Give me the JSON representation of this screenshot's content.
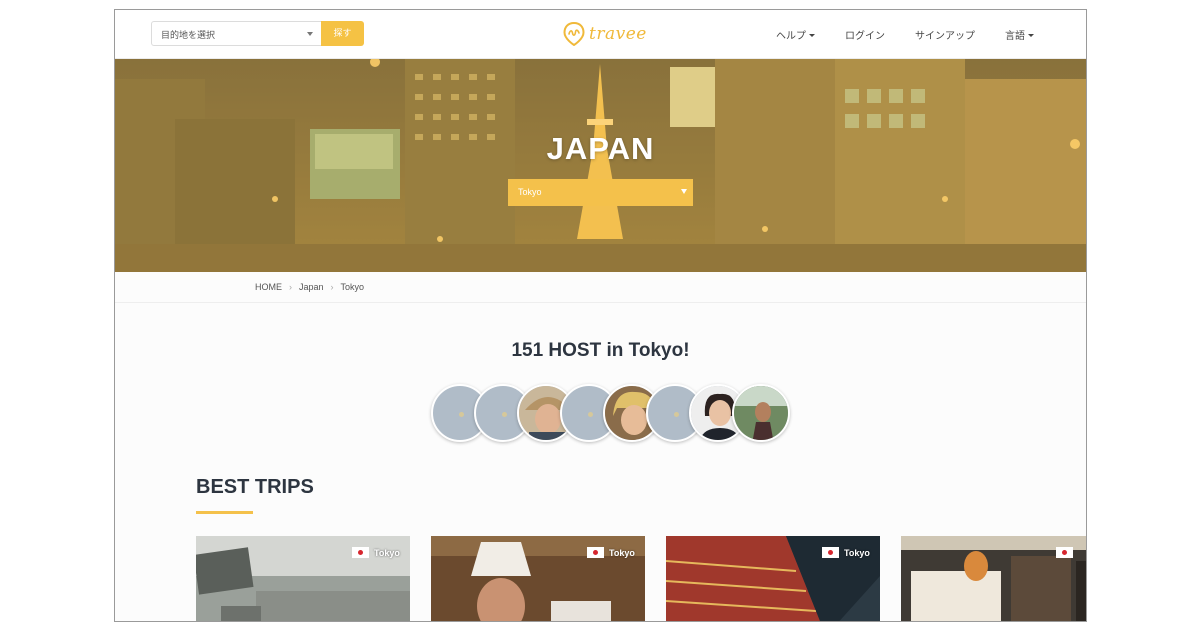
{
  "header": {
    "destination_placeholder": "目的地を選択",
    "search_label": "探す",
    "logo_text": "travee",
    "nav": [
      {
        "label": "ヘルプ",
        "dropdown": true
      },
      {
        "label": "ログイン",
        "dropdown": false
      },
      {
        "label": "サインアップ",
        "dropdown": false
      },
      {
        "label": "言語",
        "dropdown": true
      }
    ]
  },
  "hero": {
    "title": "JAPAN",
    "city_selected": "Tokyo"
  },
  "breadcrumb": [
    "HOME",
    "Japan",
    "Tokyo"
  ],
  "hosts": {
    "title": "151 HOST in Tokyo!",
    "avatars": [
      "placeholder",
      "placeholder",
      "photo-woman-hat",
      "placeholder",
      "photo-man-blond",
      "placeholder",
      "photo-woman",
      "photo-woman-outdoor"
    ]
  },
  "best_trips": {
    "title": "BEST TRIPS",
    "cards": [
      {
        "location": "Tokyo",
        "flag": "japan-flag"
      },
      {
        "location": "Tokyo",
        "flag": "japan-flag"
      },
      {
        "location": "Tokyo",
        "flag": "japan-flag"
      },
      {
        "location": "",
        "flag": "japan-flag"
      }
    ]
  },
  "colors": {
    "accent": "#f4c14b",
    "logo": "#f0b93a",
    "heading": "#2d3540",
    "avatar_placeholder": "#b0bcc8"
  }
}
